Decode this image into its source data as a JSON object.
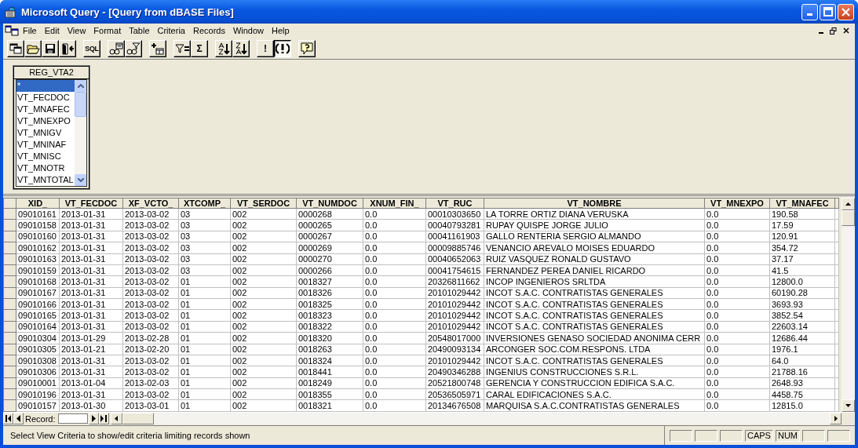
{
  "window": {
    "title": "Microsoft Query - [Query from dBASE Files]"
  },
  "menu": [
    "File",
    "Edit",
    "View",
    "Format",
    "Table",
    "Criteria",
    "Records",
    "Window",
    "Help"
  ],
  "toolbar": [
    [
      {
        "kind": "new-query",
        "pressed": false
      },
      {
        "kind": "open",
        "pressed": false
      },
      {
        "kind": "save",
        "pressed": false
      },
      {
        "kind": "return",
        "pressed": false
      }
    ],
    [
      {
        "kind": "text",
        "label": "SQL",
        "pressed": false
      }
    ],
    [
      {
        "kind": "show-tables",
        "pressed": false
      },
      {
        "kind": "show-criteria",
        "pressed": false
      }
    ],
    [
      {
        "kind": "add-tables",
        "pressed": false
      }
    ],
    [
      {
        "kind": "criteria-equals",
        "pressed": false
      },
      {
        "kind": "text",
        "label": "Σ",
        "pressed": false
      }
    ],
    [
      {
        "kind": "sort-asc",
        "pressed": false
      },
      {
        "kind": "sort-desc",
        "pressed": false
      }
    ],
    [
      {
        "kind": "text",
        "label": "!",
        "pressed": false
      },
      {
        "kind": "auto-query",
        "pressed": true
      }
    ],
    [
      {
        "kind": "help",
        "pressed": false
      }
    ]
  ],
  "table_box": {
    "title": "REG_VTA2",
    "fields": [
      {
        "name": "*",
        "selected": true
      },
      {
        "name": "VT_FECDOC",
        "selected": false
      },
      {
        "name": "VT_MNAFEC",
        "selected": false
      },
      {
        "name": "VT_MNEXPO",
        "selected": false
      },
      {
        "name": "VT_MNIGV",
        "selected": false
      },
      {
        "name": "VT_MNINAF",
        "selected": false
      },
      {
        "name": "VT_MNISC",
        "selected": false
      },
      {
        "name": "VT_MNOTR",
        "selected": false
      },
      {
        "name": "VT_MNTOTAL",
        "selected": false
      }
    ]
  },
  "grid": {
    "columns": [
      "XID_",
      "VT_FECDOC",
      "XF_VCTO_",
      "XTCOMP_",
      "VT_SERDOC",
      "VT_NUMDOC",
      "XNUM_FIN_",
      "VT_RUC",
      "VT_NOMBRE",
      "VT_MNEXPO",
      "VT_MNAFEC"
    ],
    "rows": [
      [
        "09010161",
        "2013-01-31",
        "2013-03-02",
        "03",
        "002",
        "0000268",
        "0.0",
        "00010303650",
        "LA TORRE ORTIZ DIANA VERUSKA",
        "0.0",
        "190.58"
      ],
      [
        "09010158",
        "2013-01-31",
        "2013-03-02",
        "03",
        "002",
        "0000265",
        "0.0",
        "00040793281",
        "RUPAY QUISPE JORGE JULIO",
        "0.0",
        "17.59"
      ],
      [
        "09010160",
        "2013-01-31",
        "2013-03-02",
        "03",
        "002",
        "0000267",
        "0.0",
        "00041161903",
        "GALLO RENTERIA SERGIO ALMANDO",
        "0.0",
        "120.91"
      ],
      [
        "09010162",
        "2013-01-31",
        "2013-03-02",
        "03",
        "002",
        "0000269",
        "0.0",
        "00009885746",
        "VENANCIO AREVALO MOISES EDUARDO",
        "0.0",
        "354.72"
      ],
      [
        "09010163",
        "2013-01-31",
        "2013-03-02",
        "03",
        "002",
        "0000270",
        "0.0",
        "00040652063",
        "RUIZ VASQUEZ RONALD GUSTAVO",
        "0.0",
        "37.17"
      ],
      [
        "09010159",
        "2013-01-31",
        "2013-03-02",
        "03",
        "002",
        "0000266",
        "0.0",
        "00041754615",
        "FERNANDEZ PEREA DANIEL RICARDO",
        "0.0",
        "41.5"
      ],
      [
        "09010168",
        "2013-01-31",
        "2013-03-02",
        "01",
        "002",
        "0018327",
        "0.0",
        "20326811662",
        "INCOP INGENIEROS SRLTDA",
        "0.0",
        "12800.0"
      ],
      [
        "09010167",
        "2013-01-31",
        "2013-03-02",
        "01",
        "002",
        "0018326",
        "0.0",
        "20101029442",
        "INCOT S.A.C. CONTRATISTAS GENERALES",
        "0.0",
        "60190.28"
      ],
      [
        "09010166",
        "2013-01-31",
        "2013-03-02",
        "01",
        "002",
        "0018325",
        "0.0",
        "20101029442",
        "INCOT S.A.C. CONTRATISTAS GENERALES",
        "0.0",
        "3693.93"
      ],
      [
        "09010165",
        "2013-01-31",
        "2013-03-02",
        "01",
        "002",
        "0018323",
        "0.0",
        "20101029442",
        "INCOT S.A.C. CONTRATISTAS GENERALES",
        "0.0",
        "3852.54"
      ],
      [
        "09010164",
        "2013-01-31",
        "2013-03-02",
        "01",
        "002",
        "0018322",
        "0.0",
        "20101029442",
        "INCOT S.A.C. CONTRATISTAS GENERALES",
        "0.0",
        "22603.14"
      ],
      [
        "09010304",
        "2013-01-29",
        "2013-02-28",
        "01",
        "002",
        "0018320",
        "0.0",
        "20548017000",
        "INVERSIONES GENASO SOCIEDAD ANONIMA CERR",
        "0.0",
        "12686.44"
      ],
      [
        "09010305",
        "2013-01-21",
        "2013-02-20",
        "01",
        "002",
        "0018263",
        "0.0",
        "20490093134",
        "ARCONGER  SOC.COM.RESPONS. LTDA",
        "0.0",
        "1976.1"
      ],
      [
        "09010308",
        "2013-01-31",
        "2013-03-02",
        "01",
        "002",
        "0018324",
        "0.0",
        "20101029442",
        "INCOT S.A.C. CONTRATISTAS GENERALES",
        "0.0",
        "64.0"
      ],
      [
        "09010306",
        "2013-01-31",
        "2013-03-02",
        "01",
        "002",
        "0018441",
        "0.0",
        "20490346288",
        "INGENIUS CONSTRUCCIONES S.R.L.",
        "0.0",
        "21788.16"
      ],
      [
        "09010001",
        "2013-01-04",
        "2013-02-03",
        "01",
        "002",
        "0018249",
        "0.0",
        "20521800748",
        "GERENCIA Y CONSTRUCCION EDIFICA S.A.C.",
        "0.0",
        "2648.93"
      ],
      [
        "09010196",
        "2013-01-31",
        "2013-03-02",
        "01",
        "002",
        "0018355",
        "0.0",
        "20536505971",
        "CARAL EDIFICACIONES S.A.C.",
        "0.0",
        "4458.75"
      ],
      [
        "09010157",
        "2013-01-30",
        "2013-03-01",
        "01",
        "002",
        "0018321",
        "0.0",
        "20134676508",
        "MARQUISA S.A.C.CONTRATISTAS GENERALES",
        "0.0",
        "12815.0"
      ]
    ]
  },
  "record_nav": {
    "label": "Record:"
  },
  "status_bar": {
    "text": "Select View Criteria to show/edit criteria limiting records shown",
    "indicators": [
      "CAPS",
      "NUM"
    ]
  }
}
